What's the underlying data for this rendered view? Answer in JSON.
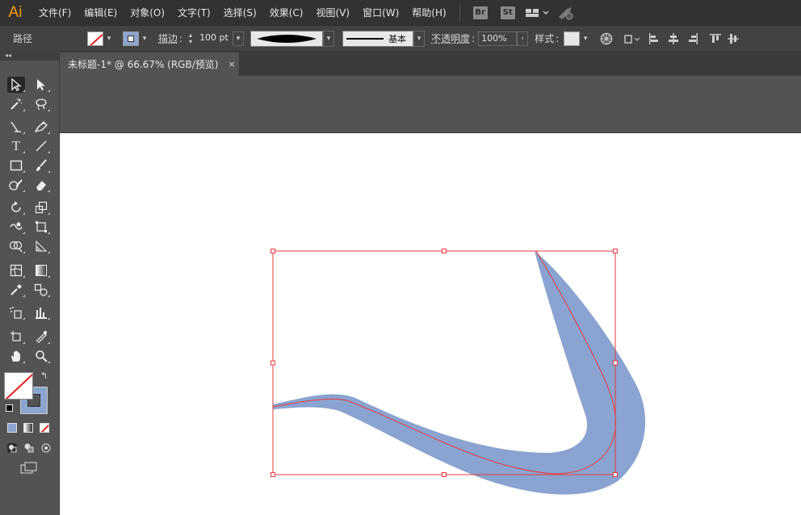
{
  "app": {
    "logo": "Ai"
  },
  "menu": [
    "文件(F)",
    "编辑(E)",
    "对象(O)",
    "文字(T)",
    "选择(S)",
    "效果(C)",
    "视图(V)",
    "窗口(W)",
    "帮助(H)"
  ],
  "app_buttons": {
    "bridge": "Br",
    "stock": "St"
  },
  "control": {
    "selection_type": "路径",
    "stroke_label": "描边",
    "stroke_value": "100 pt",
    "profile_label": "基本",
    "opacity_label": "不透明度",
    "opacity_value": "100%",
    "style_label": "样式"
  },
  "document_tab": {
    "title": "未标题-1* @ 66.67% (RGB/预览)",
    "close": "×"
  },
  "toolbox": {
    "collapse": "◂◂"
  },
  "colors": {
    "fill_shape": "#8aa3d0",
    "selection": "#e8383d",
    "ai_logo": "#ff9a00"
  }
}
